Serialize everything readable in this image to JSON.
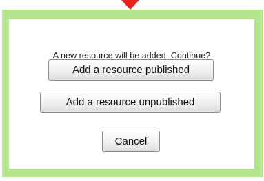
{
  "dialog": {
    "message": "A new resource will be added. Continue?",
    "buttons": {
      "published_label": "Add a resource published",
      "unpublished_label": "Add a resource unpublished",
      "cancel_label": "Cancel"
    }
  },
  "colors": {
    "frame": "#b5e58c",
    "pointer": "#e8221f"
  },
  "icons": {
    "pointer": "down-arrow-pointer-icon"
  }
}
